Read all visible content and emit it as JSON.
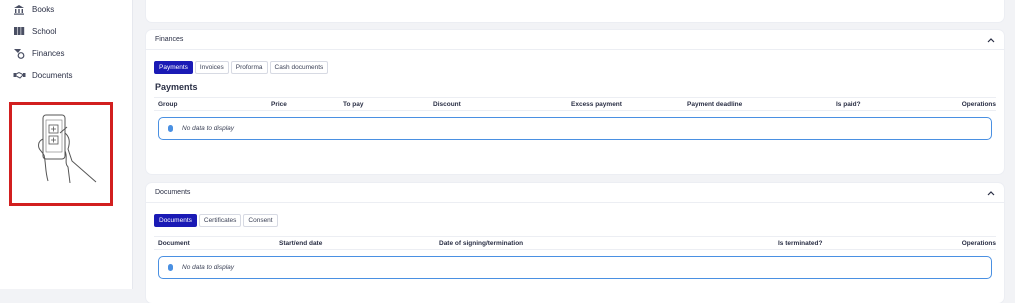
{
  "sidebar": {
    "items": [
      {
        "label": "Books",
        "icon": "bank-icon"
      },
      {
        "label": "School",
        "icon": "books-icon"
      },
      {
        "label": "Finances",
        "icon": "coins-icon"
      },
      {
        "label": "Documents",
        "icon": "handshake-icon"
      }
    ],
    "promo": {
      "icon": "phone-in-hand-icon"
    }
  },
  "finances": {
    "title": "Finances",
    "tabs": [
      "Payments",
      "Invoices",
      "Proforma",
      "Cash documents"
    ],
    "active_tab": "Payments",
    "section_title": "Payments",
    "columns": [
      "Group",
      "Price",
      "To pay",
      "Discount",
      "Excess payment",
      "Payment deadline",
      "Is paid?",
      "Operations"
    ],
    "empty_text": "No data to display"
  },
  "documents": {
    "title": "Documents",
    "tabs": [
      "Documents",
      "Certificates",
      "Consent"
    ],
    "active_tab": "Documents",
    "columns": [
      "Document",
      "Start/end date",
      "Date of signing/termination",
      "Is terminated?",
      "Operations"
    ],
    "empty_text": "No data to display"
  },
  "colors": {
    "accent": "#1a1ab5",
    "info": "#4a90e2",
    "highlight_border": "#d21f1f"
  }
}
